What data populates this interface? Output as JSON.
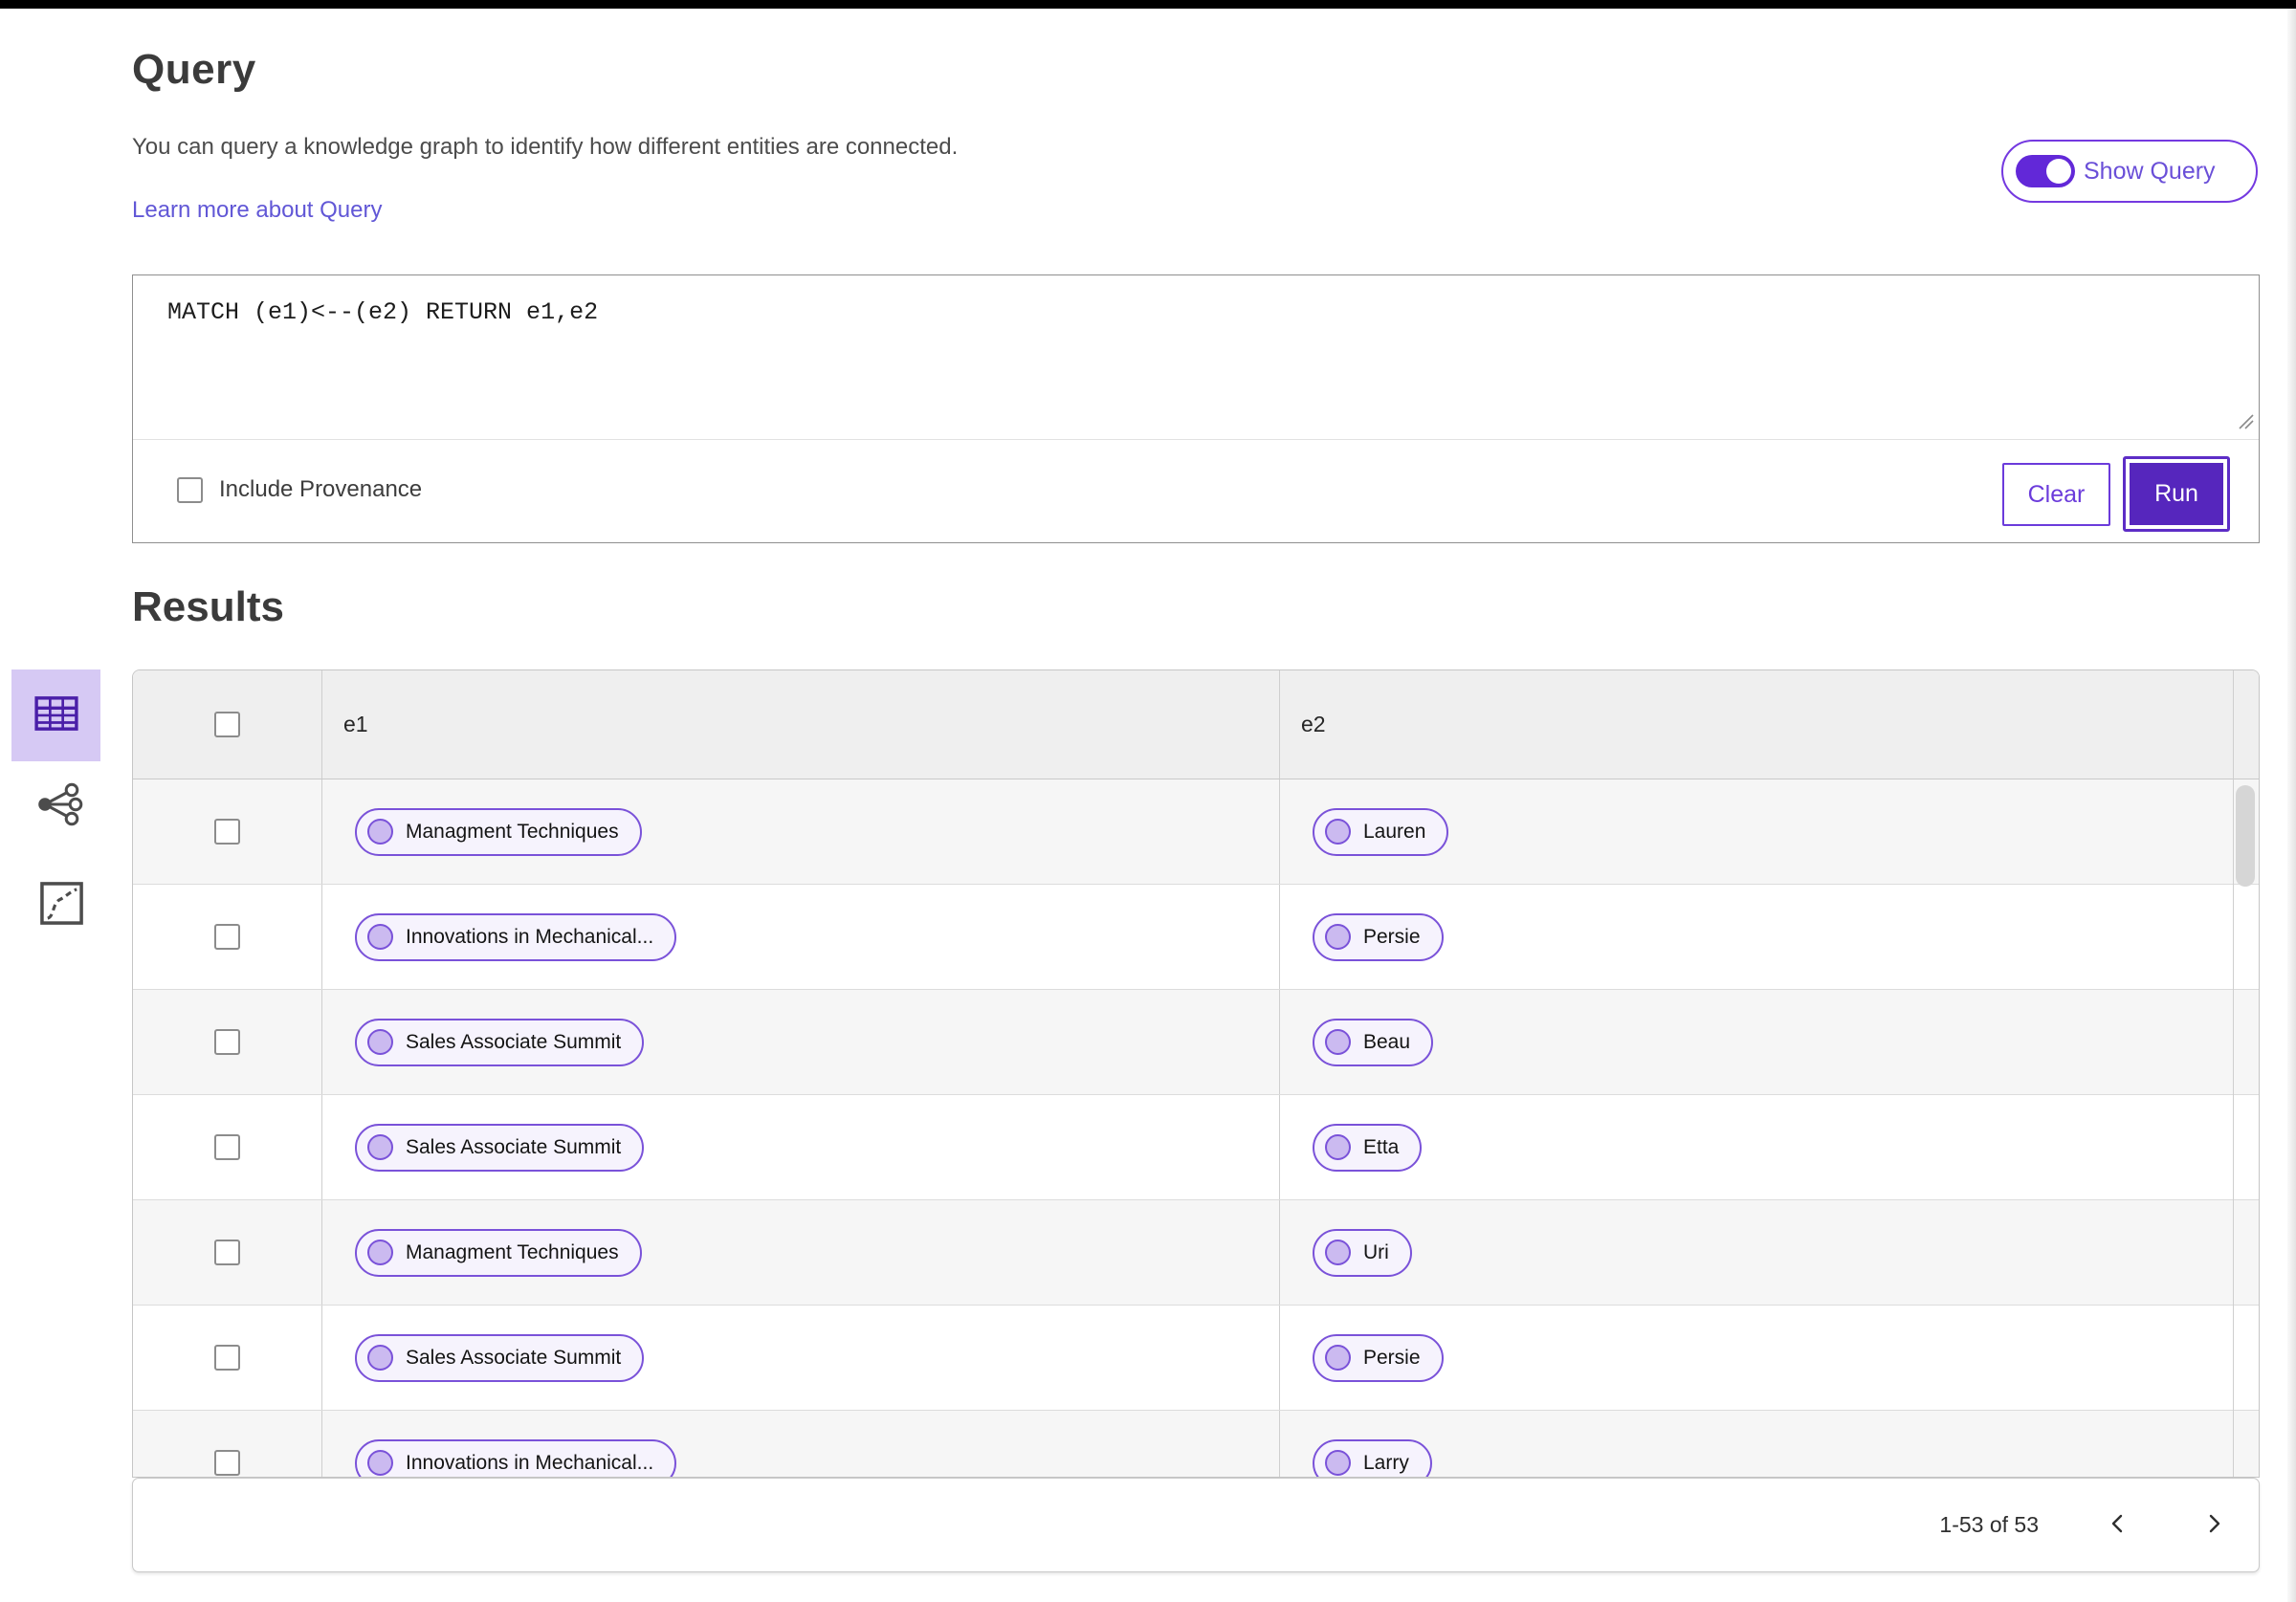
{
  "colors": {
    "accent_fill": "#5626bd",
    "accent_border": "#6b3bdb",
    "link": "#6157d6",
    "pill_border": "#7a52d9",
    "selected_view_bg": "#d6c9f4"
  },
  "query_section": {
    "title": "Query",
    "description": "You can query a knowledge graph to identify how different entities are connected.",
    "learn_more_link": "Learn more about Query",
    "show_query_label": "Show Query",
    "show_query_on": true,
    "query_text": "MATCH (e1)<--(e2) RETURN e1,e2",
    "include_provenance_label": "Include Provenance",
    "include_provenance_checked": false,
    "clear_button": "Clear",
    "run_button": "Run"
  },
  "results_section": {
    "title": "Results",
    "views": [
      {
        "name": "table-view",
        "selected": true
      },
      {
        "name": "graph-view",
        "selected": false
      },
      {
        "name": "chart-view",
        "selected": false
      }
    ],
    "table": {
      "columns": [
        "e1",
        "e2"
      ],
      "rows": [
        {
          "e1": "Managment Techniques",
          "e2": "Lauren"
        },
        {
          "e1": "Innovations in Mechanical...",
          "e2": "Persie"
        },
        {
          "e1": "Sales Associate Summit",
          "e2": "Beau"
        },
        {
          "e1": "Sales Associate Summit",
          "e2": "Etta"
        },
        {
          "e1": "Managment Techniques",
          "e2": "Uri"
        },
        {
          "e1": "Sales Associate Summit",
          "e2": "Persie"
        },
        {
          "e1": "Innovations in Mechanical...",
          "e2": "Larry"
        }
      ]
    },
    "pagination": {
      "range_label": "1-53 of 53"
    }
  }
}
